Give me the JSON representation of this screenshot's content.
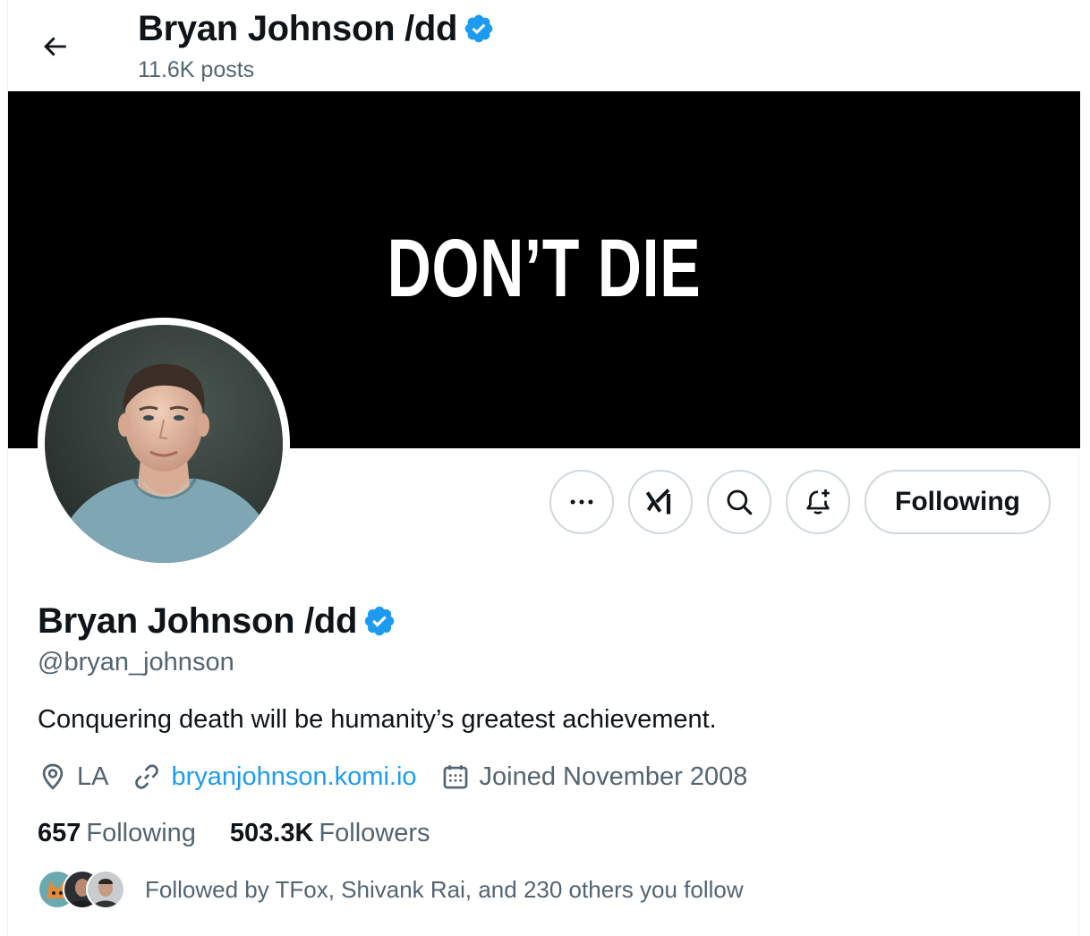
{
  "header": {
    "name": "Bryan Johnson /dd",
    "posts": "11.6K posts"
  },
  "banner": {
    "text": "DON’T DIE"
  },
  "actions": {
    "following_label": "Following"
  },
  "profile": {
    "name": "Bryan Johnson /dd",
    "handle": "@bryan_johnson",
    "bio": "Conquering death will be humanity’s greatest achievement.",
    "location": "LA",
    "website": "bryanjohnson.komi.io",
    "joined": "Joined November 2008",
    "following_count": "657",
    "following_label": "Following",
    "followers_count": "503.3K",
    "followers_label": "Followers",
    "followed_by": "Followed by TFox, Shivank Rai, and 230 others you follow"
  },
  "colors": {
    "accent": "#1d9bf0",
    "text_primary": "#0f1419",
    "text_secondary": "#536471",
    "border": "#cfd9de",
    "banner_bg": "#000000"
  },
  "icons": {
    "back": "arrow-left-icon",
    "verified": "verified-badge-icon",
    "more": "more-dots-icon",
    "grok": "grok-icon",
    "search": "search-icon",
    "notify": "bell-plus-icon",
    "location": "location-pin-icon",
    "link": "link-icon",
    "calendar": "calendar-icon"
  }
}
